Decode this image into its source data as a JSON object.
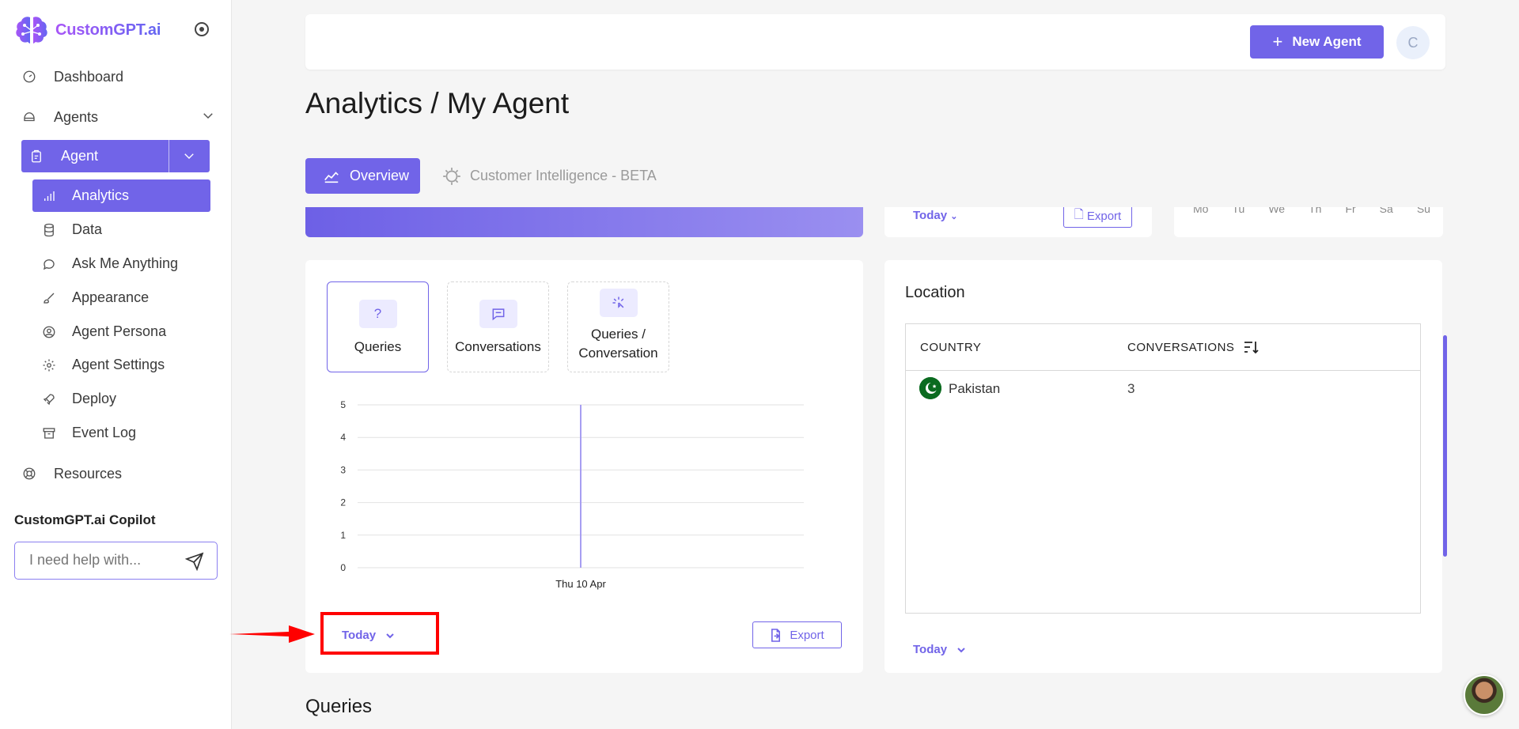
{
  "brand": {
    "name": "CustomGPT.ai",
    "accent": "#7164e8"
  },
  "sidebar": {
    "items": [
      {
        "label": "Dashboard",
        "icon": "dashboard-icon"
      },
      {
        "label": "Agents",
        "icon": "agents-icon"
      }
    ],
    "agent_button": {
      "label": "Agent",
      "icon": "clipboard-icon"
    },
    "sub_items": [
      {
        "label": "Analytics",
        "icon": "bar-chart-icon",
        "active": true
      },
      {
        "label": "Data",
        "icon": "database-icon"
      },
      {
        "label": "Ask Me Anything",
        "icon": "chat-icon"
      },
      {
        "label": "Appearance",
        "icon": "brush-icon"
      },
      {
        "label": "Agent Persona",
        "icon": "user-circle-icon"
      },
      {
        "label": "Agent Settings",
        "icon": "gear-icon"
      },
      {
        "label": "Deploy",
        "icon": "rocket-icon"
      },
      {
        "label": "Event Log",
        "icon": "archive-icon"
      }
    ],
    "resources": {
      "label": "Resources",
      "icon": "lifebuoy-icon"
    },
    "copilot": {
      "title": "CustomGPT.ai Copilot",
      "placeholder": "I need help with..."
    }
  },
  "header": {
    "new_agent_label": "New Agent",
    "avatar_initial": "C"
  },
  "page": {
    "title": "Analytics / My Agent"
  },
  "tabs": [
    {
      "label": "Overview",
      "active": true
    },
    {
      "label": "Customer Intelligence - BETA",
      "active": false
    }
  ],
  "top_cards": {
    "today_label": "Today",
    "export_label": "Export",
    "weekdays": [
      "Mo",
      "Tu",
      "We",
      "Th",
      "Fr",
      "Sa",
      "Su"
    ]
  },
  "metrics": [
    {
      "label": "Queries",
      "selected": true
    },
    {
      "label": "Conversations",
      "selected": false
    },
    {
      "label": "Queries / Conversation",
      "selected": false
    }
  ],
  "chart_data": {
    "type": "bar",
    "categories": [
      "Thu 10 Apr"
    ],
    "values": [
      5
    ],
    "yticks": [
      0,
      1,
      2,
      3,
      4,
      5
    ],
    "ylim": [
      0,
      5
    ],
    "title": "",
    "xlabel": "",
    "ylabel": "",
    "grid": true
  },
  "queries_card": {
    "range_label": "Today",
    "export_label": "Export"
  },
  "location": {
    "title": "Location",
    "columns": [
      "COUNTRY",
      "CONVERSATIONS"
    ],
    "rows": [
      {
        "country": "Pakistan",
        "conversations": "3"
      }
    ],
    "range_label": "Today"
  },
  "section_below": {
    "title": "Queries"
  }
}
